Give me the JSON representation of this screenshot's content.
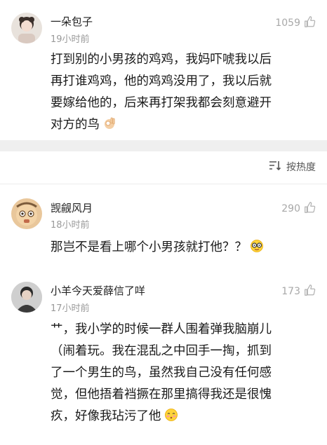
{
  "comments": [
    {
      "username": "一朵包子",
      "time": "19小时前",
      "likes": "1059",
      "lines": [
        "打到别的小男孩的鸡鸡，我妈吓唬我以后",
        "再打谁鸡鸡，他的鸡鸡没用了，我以后就",
        "要嫁给他的，后来再打架我都会刻意避开",
        "对方的鸟"
      ],
      "emoji": "ok-hand-emoji"
    },
    {
      "username": "觊觎风月",
      "time": "18小时前",
      "likes": "290",
      "lines": [
        "那岂不是看上哪个小男孩就打他？？"
      ],
      "emoji": "glasses-face-emoji"
    },
    {
      "username": "小羊今天爱薛信了咩",
      "time": "17小时前",
      "likes": "173",
      "lines": [
        "艹，我小学的时候一群人围着弹我脑崩儿",
        "（闹着玩。我在混乱之中回手一掏，抓到",
        "了一个男生的鸟，虽然我自己没有任何感",
        "觉，但他捂着裆撅在那里搞得我还是很愧",
        "疚，好像我玷污了他"
      ],
      "emoji": "blush-face-emoji"
    }
  ],
  "sort": {
    "label": "按热度",
    "icon": "sort-icon"
  },
  "colors": {
    "divider": "#efefef",
    "meta": "#9a9a9a",
    "text": "#1a1a1a"
  }
}
